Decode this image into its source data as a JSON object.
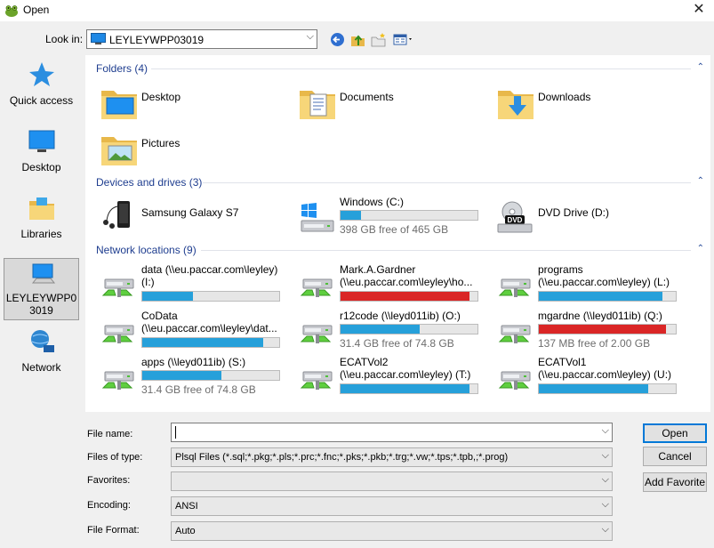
{
  "window": {
    "title": "Open",
    "close_glyph": "✕"
  },
  "toolbar": {
    "look_in_label": "Look in:",
    "look_in_value": "LEYLEYWPP03019",
    "icons": [
      "back-arrow-icon",
      "up-folder-icon",
      "new-folder-icon",
      "view-menu-icon"
    ]
  },
  "places": [
    {
      "label": "Quick access",
      "icon": "star-icon"
    },
    {
      "label": "Desktop",
      "icon": "desktop-icon"
    },
    {
      "label": "Libraries",
      "icon": "libraries-icon"
    },
    {
      "label": "LEYLEYWPP03019",
      "icon": "computer-icon",
      "selected": true
    },
    {
      "label": "Network",
      "icon": "network-icon"
    }
  ],
  "groups": {
    "folders": {
      "title": "Folders (4)"
    },
    "devices": {
      "title": "Devices and drives (3)"
    },
    "network": {
      "title": "Network locations (9)"
    }
  },
  "folders": [
    {
      "name": "Desktop"
    },
    {
      "name": "Documents"
    },
    {
      "name": "Downloads"
    },
    {
      "name": "Pictures"
    }
  ],
  "devices": [
    {
      "name": "Samsung Galaxy S7",
      "icon": "phone-icon"
    },
    {
      "name": "Windows (C:)",
      "icon": "windows-drive-icon",
      "used_fraction": 0.15,
      "free_text": "398 GB free of 465 GB"
    },
    {
      "name": "DVD Drive (D:)",
      "icon": "dvd-drive-icon"
    }
  ],
  "network": [
    {
      "name": "data (\\\\eu.paccar.com\\leyley)",
      "name2": "(I:)",
      "used_fraction": 0.37,
      "color": "#26a0da"
    },
    {
      "name": "Mark.A.Gardner",
      "name2": "(\\\\eu.paccar.com\\leyley\\ho...",
      "used_fraction": 0.94,
      "color": "#da2626"
    },
    {
      "name": "programs",
      "name2": "(\\\\eu.paccar.com\\leyley) (L:)",
      "used_fraction": 0.9,
      "color": "#26a0da"
    },
    {
      "name": "CoData",
      "name2": "(\\\\eu.paccar.com\\leyley\\dat...",
      "used_fraction": 0.88,
      "color": "#26a0da"
    },
    {
      "name": "r12code (\\\\leyd011ib) (O:)",
      "name2": "",
      "used_fraction": 0.58,
      "free_text": "31.4 GB free of 74.8 GB",
      "color": "#26a0da"
    },
    {
      "name": "mgardne (\\\\leyd011ib) (Q:)",
      "name2": "",
      "used_fraction": 0.93,
      "free_text": "137 MB free of 2.00 GB",
      "color": "#da2626"
    },
    {
      "name": "apps (\\\\leyd011ib) (S:)",
      "name2": "",
      "used_fraction": 0.58,
      "free_text": "31.4 GB free of 74.8 GB",
      "color": "#26a0da"
    },
    {
      "name": "ECATVol2",
      "name2": "(\\\\eu.paccar.com\\leyley) (T:)",
      "used_fraction": 0.94,
      "color": "#26a0da"
    },
    {
      "name": "ECATVol1",
      "name2": "(\\\\eu.paccar.com\\leyley) (U:)",
      "used_fraction": 0.8,
      "color": "#26a0da"
    }
  ],
  "fields": {
    "file_name": {
      "label": "File name:",
      "value": ""
    },
    "files_of_type": {
      "label": "Files of type:",
      "value": "Plsql Files (*.sql;*.pkg;*.pls;*.prc;*.fnc;*.pks;*.pkb;*.trg;*.vw;*.tps;*.tpb,;*.prog)"
    },
    "favorites": {
      "label": "Favorites:",
      "value": ""
    },
    "encoding": {
      "label": "Encoding:",
      "value": "ANSI"
    },
    "file_format": {
      "label": "File Format:",
      "value": "Auto"
    }
  },
  "buttons": {
    "open": "Open",
    "cancel": "Cancel",
    "add_favorite": "Add Favorite"
  },
  "colors": {
    "accent": "#0078d7",
    "group_title": "#1e3d8f",
    "bar_normal": "#26a0da",
    "bar_full": "#da2626"
  }
}
